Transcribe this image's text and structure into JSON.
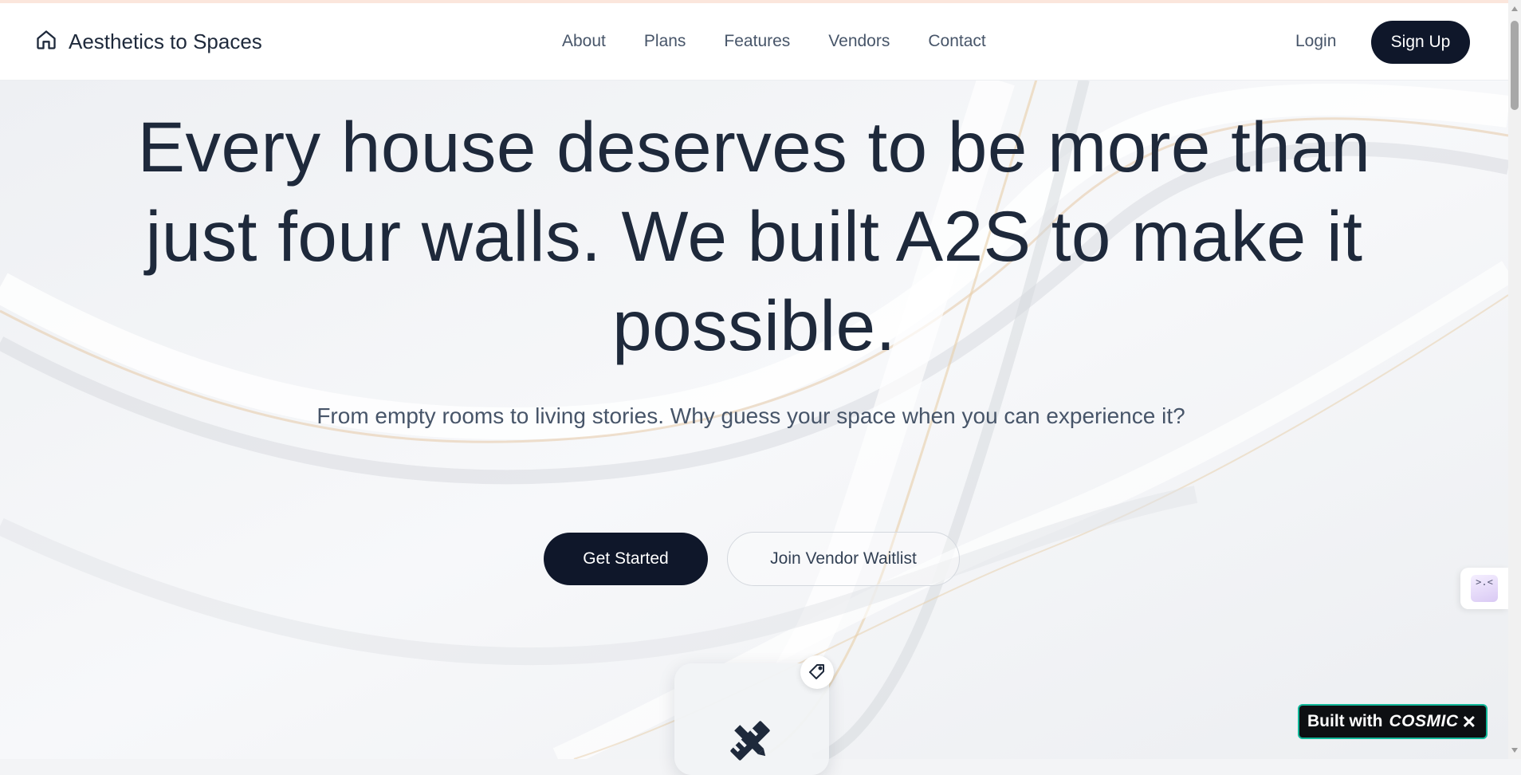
{
  "brand": {
    "name": "Aesthetics to Spaces",
    "icon": "home-icon"
  },
  "nav": {
    "items": [
      {
        "label": "About"
      },
      {
        "label": "Plans"
      },
      {
        "label": "Features"
      },
      {
        "label": "Vendors"
      },
      {
        "label": "Contact"
      }
    ],
    "login_label": "Login",
    "signup_label": "Sign Up"
  },
  "hero": {
    "title": "Every house deserves to be more than just four walls. We built A2S to make it possible.",
    "subtitle": "From empty rooms to living stories. Why guess your space when you can experience it?",
    "primary_cta": "Get Started",
    "secondary_cta": "Join Vendor Waitlist"
  },
  "feature_card": {
    "icon": "ruler-pencil-icon",
    "badge_icon": "tag-icon"
  },
  "side_widget": {
    "face": ">.<"
  },
  "cosmic_badge": {
    "prefix": "Built with",
    "brand": "COSMIC",
    "close": "✕"
  },
  "colors": {
    "primary": "#0f172a",
    "text": "#1e293b",
    "muted": "#475569",
    "accent_line": "#fbe6dc",
    "cosmic_border": "#12b89a"
  }
}
